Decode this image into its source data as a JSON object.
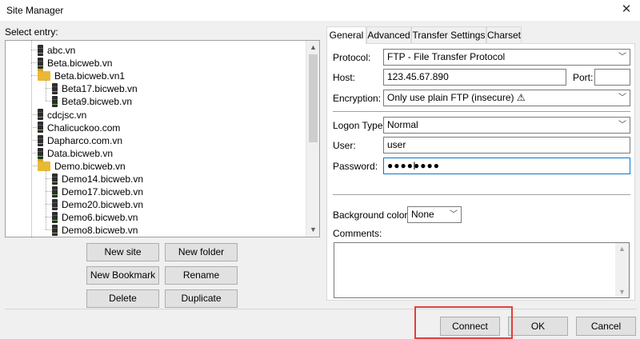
{
  "window": {
    "title": "Site Manager",
    "close_glyph": "✕"
  },
  "tree": {
    "label": "Select entry:",
    "items": [
      {
        "label": "abc.vn",
        "type": "site",
        "depth": 1
      },
      {
        "label": "Beta.bicweb.vn",
        "type": "site",
        "depth": 1
      },
      {
        "label": "Beta.bicweb.vn1",
        "type": "folder",
        "depth": 1
      },
      {
        "label": "Beta17.bicweb.vn",
        "type": "site",
        "depth": 2
      },
      {
        "label": "Beta9.bicweb.vn",
        "type": "site",
        "depth": 2
      },
      {
        "label": "cdcjsc.vn",
        "type": "site",
        "depth": 1
      },
      {
        "label": "Chalicuckoo.com",
        "type": "site",
        "depth": 1
      },
      {
        "label": "Dapharco.com.vn",
        "type": "site",
        "depth": 1
      },
      {
        "label": "Data.bicweb.vn",
        "type": "site",
        "depth": 1
      },
      {
        "label": "Demo.bicweb.vn",
        "type": "folder",
        "depth": 1
      },
      {
        "label": "Demo14.bicweb.vn",
        "type": "site",
        "depth": 2
      },
      {
        "label": "Demo17.bicweb.vn",
        "type": "site",
        "depth": 2
      },
      {
        "label": "Demo20.bicweb.vn",
        "type": "site",
        "depth": 2
      },
      {
        "label": "Demo6.bicweb.vn",
        "type": "site",
        "depth": 2
      },
      {
        "label": "Demo8.bicweb.vn",
        "type": "site",
        "depth": 2
      }
    ]
  },
  "entry_buttons": {
    "new_site": "New site",
    "new_folder": "New folder",
    "new_bookmark": "New Bookmark",
    "rename": "Rename",
    "delete": "Delete",
    "duplicate": "Duplicate"
  },
  "tabs": [
    "General",
    "Advanced",
    "Transfer Settings",
    "Charset"
  ],
  "active_tab": "General",
  "general": {
    "protocol_label": "Protocol:",
    "protocol_value": "FTP - File Transfer Protocol",
    "host_label": "Host:",
    "host_value": "123.45.67.890",
    "port_label": "Port:",
    "port_value": "",
    "encryption_label": "Encryption:",
    "encryption_value": "Only use plain FTP (insecure) ⚠",
    "logon_type_label": "Logon Type:",
    "logon_type_value": "Normal",
    "user_label": "User:",
    "user_value": "user",
    "password_label": "Password:",
    "password_value": "●●●●●●●●",
    "bg_color_label": "Background color:",
    "bg_color_value": "None",
    "comments_label": "Comments:"
  },
  "footer": {
    "connect": "Connect",
    "ok": "OK",
    "cancel": "Cancel"
  },
  "colors": {
    "accent_focus": "#0078d7",
    "highlight_box": "#e0403f",
    "folder": "#e8b936"
  },
  "icons": {
    "dropdown": "chevron-down-icon",
    "scroll_up": "triangle-up-icon",
    "scroll_down": "triangle-down-icon"
  }
}
